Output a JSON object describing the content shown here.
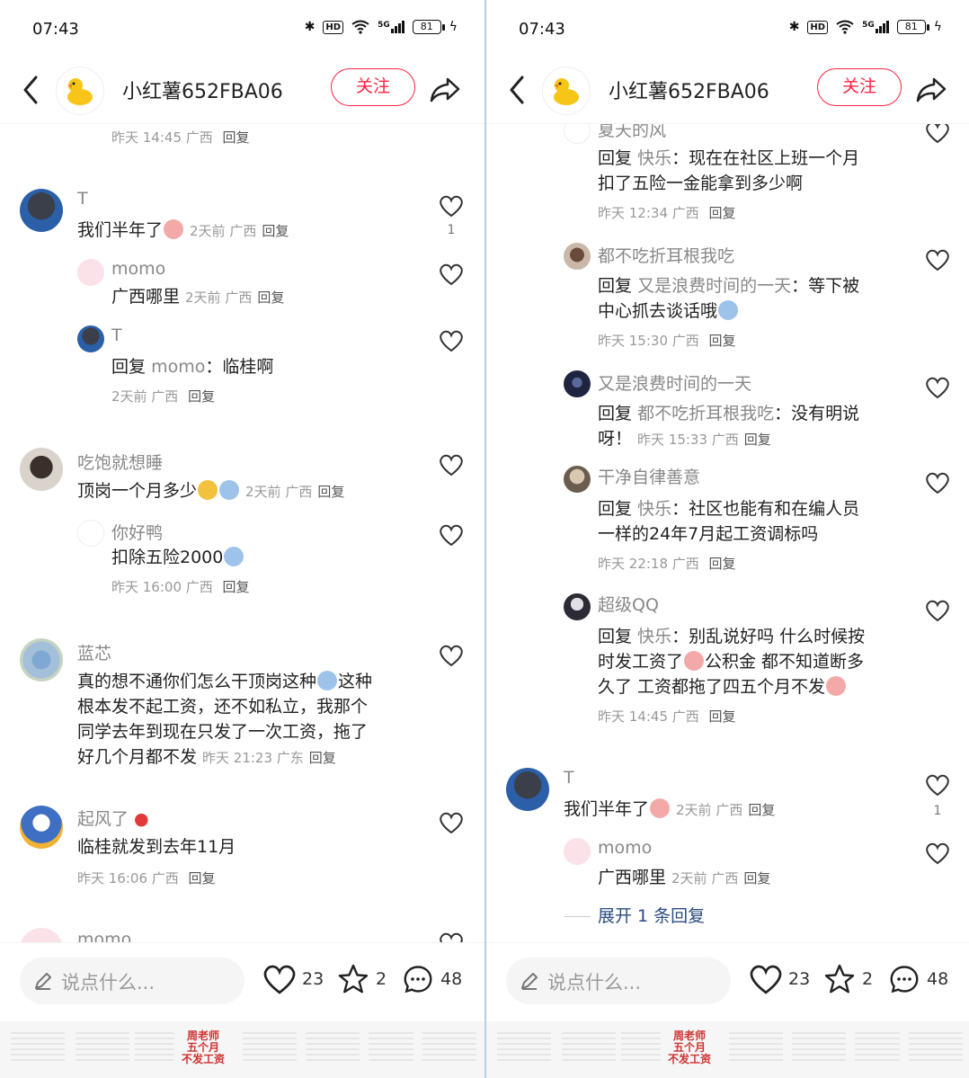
{
  "colors": {
    "accent": "#ff2442",
    "muted": "#999999",
    "link": "#2b4c7e"
  },
  "status_bar": {
    "time": "07:43",
    "network": "5G",
    "battery": "81"
  },
  "header": {
    "author_name": "小红薯652FBA06",
    "follow_label": "关注"
  },
  "bottom_bar": {
    "input_placeholder": "说点什么...",
    "likes": "23",
    "favorites": "2",
    "comments": "48"
  },
  "common": {
    "reply": "回复"
  },
  "thumbnail_text": "周老师\n五个月\n不发工资",
  "left_panel": {
    "c0": {
      "meta": "昨天 14:45 广西"
    },
    "c1": {
      "user": "T",
      "text": "我们半年了",
      "meta": "2天前 广西",
      "likes": "1"
    },
    "c1r1": {
      "user": "momo",
      "text": "广西哪里",
      "meta": "2天前 广西"
    },
    "c1r2": {
      "user": "T",
      "reply_to": "momo",
      "text": "临桂啊",
      "meta": "2天前 广西"
    },
    "c2": {
      "user": "吃饱就想睡",
      "text": "顶岗一个月多少",
      "meta": "2天前 广西"
    },
    "c2r1": {
      "user": "你好鸭",
      "text": "扣除五险2000",
      "meta": "昨天 16:00 广西"
    },
    "c3": {
      "user": "蓝芯",
      "line1a": "真的想不通你们怎么干顶岗这种",
      "line1b": "这种",
      "line2": "根本发不起工资，还不如私立，我那个",
      "line3": "同学去年到现在只发了一次工资，拖了",
      "line4": "好几个月都不发",
      "meta": "昨天 21:23 广东"
    },
    "c4": {
      "user": "起风了",
      "text": "临桂就发到去年11月",
      "meta": "昨天 16:06 广西"
    },
    "c5": {
      "user": "momo"
    }
  },
  "right_panel": {
    "r0": {
      "user": "夏天的风",
      "reply_to": "快乐",
      "line1": "现在在社区上班一个月",
      "line2": "扣了五险一金能拿到多少啊",
      "meta": "昨天 12:34 广西"
    },
    "r1": {
      "user": "都不吃折耳根我吃",
      "reply_to": "又是浪费时间的一天",
      "line1": "等下被",
      "line2": "中心抓去谈话哦",
      "meta": "昨天 15:30 广西"
    },
    "r2": {
      "user": "又是浪费时间的一天",
      "reply_to": "都不吃折耳根我吃",
      "line1": "没有明说",
      "line2": "呀！",
      "meta": "昨天 15:33 广西"
    },
    "r3": {
      "user": "干净自律善意",
      "reply_to": "快乐",
      "line1": "社区也能有和在编人员",
      "line2": "一样的24年7月起工资调标吗",
      "meta": "昨天 22:18 广西"
    },
    "r4": {
      "user": "超级QQ",
      "reply_to": "快乐",
      "line1": "别乱说好吗 什么时候按",
      "line2a": "时发工资了",
      "line2b": "公积金 都不知道断多",
      "line3": "久了 工资都拖了四五个月不发",
      "meta": "昨天 14:45 广西"
    },
    "r5": {
      "user": "T",
      "text": "我们半年了",
      "meta": "2天前 广西",
      "likes": "1"
    },
    "r5r1": {
      "user": "momo",
      "text": "广西哪里",
      "meta": "2天前 广西"
    },
    "expand": "展开 1 条回复"
  }
}
